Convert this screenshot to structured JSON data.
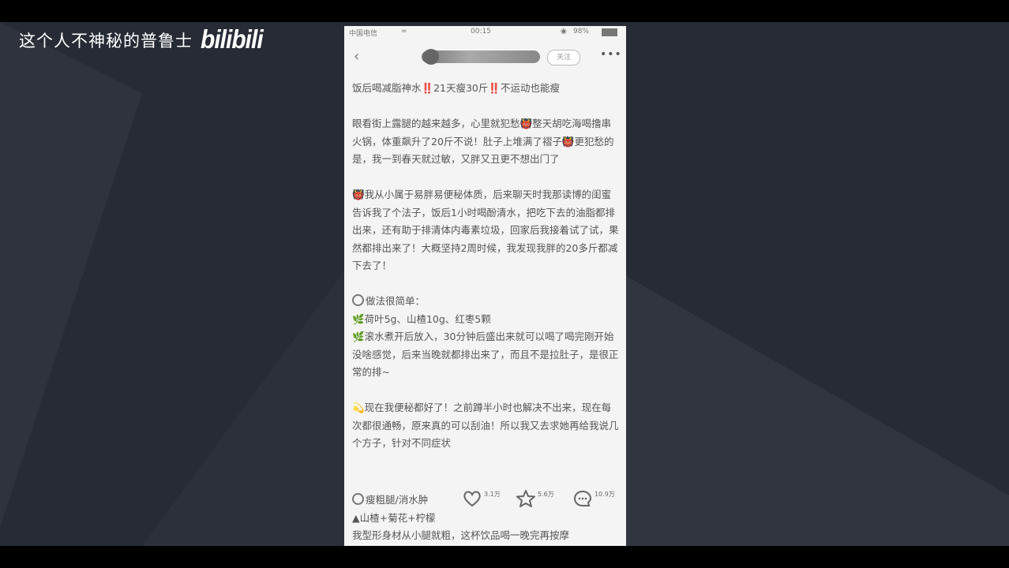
{
  "watermark": {
    "text": "这个人不神秘的普鲁士",
    "logo": "bilibili"
  },
  "status": {
    "carrier": "中国电信",
    "wifi": "≈",
    "time": "00:15",
    "battery": "98%"
  },
  "nav": {
    "back": "‹",
    "follow_label": "关注",
    "more": "•••"
  },
  "post": {
    "title": "饭后喝减脂神水‼️21天瘦30斤‼️不运动也能瘦",
    "para1": "眼看街上露腿的越来越多，心里就犯愁👹整天胡吃海喝撸串火锅，体重飙升了20斤不说！肚子上堆满了褶子👹更犯愁的是，我一到春天就过敏，又胖又丑更不想出门了",
    "para2": "👹我从小属于易胖易便秘体质，后来聊天时我那读博的闺蜜告诉我了个法子，饭后1小时喝酚清水，把吃下去的油脂都排出来，还有助于排清体内毒素垃圾，回家后我接着试了试，果然都排出来了！大概坚持2周时候，我发现我胖的20多斤都减下去了！",
    "method_title": "做法很简单：",
    "method_line1": "🌿荷叶5g、山楂10g、红枣5颗",
    "method_line2": "🌿滚水煮开后放入，30分钟后盛出来就可以喝了喝完刚开始没啥感觉，后来当晚就都排出来了，而且不是拉肚子，是很正常的排~",
    "para3": "💫现在我便秘都好了！之前蹲半小时也解决不出来，现在每次都很通畅，原来真的可以刮油！所以我又去求她再给我说几个方子，针对不同症状",
    "tip_title": "瘦粗腿/消水肿",
    "tip_line": "▲山楂+菊花+柠檬",
    "tip_line2": "我型形身材从小腿就粗，这杯饮品喝一晚完再按摩"
  },
  "actions": {
    "likes": "3.1万",
    "stars": "5.6万",
    "comments": "10.9万"
  }
}
